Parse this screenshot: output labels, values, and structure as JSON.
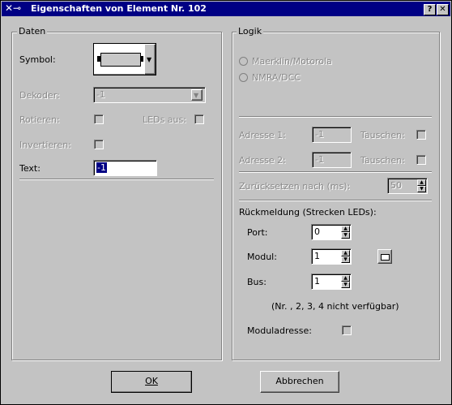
{
  "window": {
    "title": "Eigenschaften von Element Nr. 102",
    "icon": "x-window-icon",
    "help_label": "?",
    "close_label": "✕"
  },
  "daten": {
    "legend": "Daten",
    "symbol_label": "Symbol:",
    "dekoder_label": "Dekoder:",
    "dekoder_value": "-1",
    "rotieren_label": "Rotieren:",
    "leds_aus_label": "LEDs aus:",
    "invertieren_label": "Invertieren:",
    "text_label": "Text:",
    "text_value": "-1"
  },
  "logik": {
    "legend": "Logik",
    "radio_maerklin": "Maerklin/Motorola",
    "radio_nmra": "NMRA/DCC",
    "adresse1_label": "Adresse 1:",
    "adresse1_value": "-1",
    "tauschen1_label": "Tauschen:",
    "adresse2_label": "Adresse 2:",
    "adresse2_value": "-1",
    "tauschen2_label": "Tauschen:",
    "zuruecksetzen_label": "Zurücksetzen nach (ms):",
    "zuruecksetzen_value": "50",
    "rueckmeldung_label": "Rückmeldung (Strecken LEDs):",
    "port_label": "Port:",
    "port_value": "0",
    "modul_label": "Modul:",
    "modul_value": "1",
    "bus_label": "Bus:",
    "bus_value": "1",
    "hint": "(Nr. , 2, 3, 4 nicht verfügbar)",
    "moduladresse_label": "Moduladresse:"
  },
  "buttons": {
    "ok": "OK",
    "abbrechen": "Abbrechen"
  }
}
